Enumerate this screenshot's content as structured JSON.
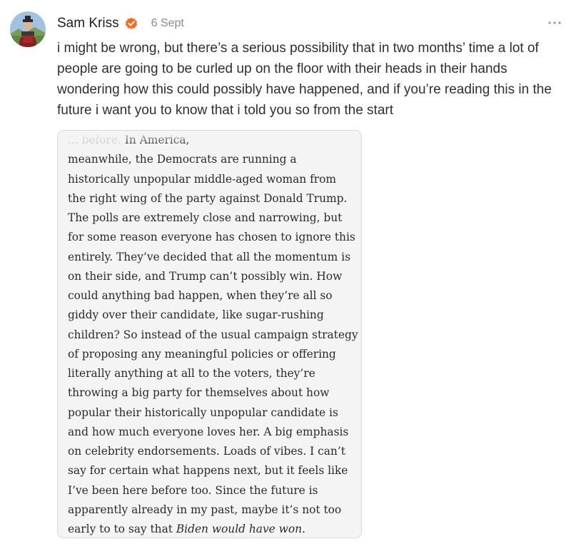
{
  "post": {
    "author": "Sam Kriss",
    "date": "6 Sept",
    "text": "i might be wrong, but there’s a serious possibility that in two months’ time a lot of people are going to be curled up on the floor with their heads in their hands wondering how this could possibly have happened, and if you’re reading this in the future i want you to know that i told you so from the start"
  },
  "icons": {
    "verified": "verified-check-icon",
    "more": "more-options-icon"
  },
  "colors": {
    "verified_badge": "#FF6719",
    "card_background": "#f4f4f4",
    "date_text": "#8a8a8a"
  },
  "quote": {
    "first_line_faint": "... before.",
    "first_line_rest": " In America,",
    "lines": [
      "meanwhile, the Democrats are running a",
      "historically unpopular middle-aged woman from",
      "the right wing of the party against Donald Trump.",
      "The polls are extremely close and narrowing, but",
      "for some reason everyone has chosen to ignore this",
      "entirely. They’ve decided that all the momentum is",
      "on their side, and Trump can’t possibly win. How",
      "could anything bad happen, when they’re all so",
      "giddy over their candidate, like sugar-rushing",
      "children? So instead of the usual campaign strategy",
      "of proposing any meaningful policies or offering",
      "literally anything at all to the voters, they’re",
      "throwing a big party for themselves about how",
      "popular their historically unpopular candidate is",
      "and how much everyone loves her. A big emphasis",
      "on celebrity endorsements. Loads of vibes. I can’t",
      "say for certain what happens next, but it feels like",
      "I’ve been here before too. Since the future is",
      "apparently already in my past, maybe it’s not too"
    ],
    "last_line_plain": "early to to say that ",
    "last_line_italic": "Biden would have won",
    "last_line_end": "."
  }
}
